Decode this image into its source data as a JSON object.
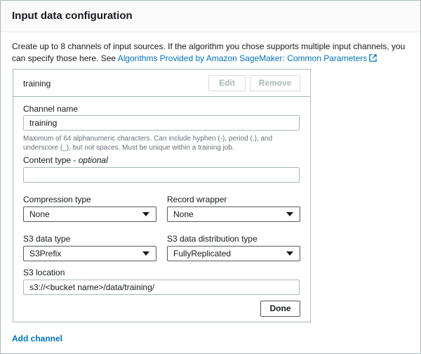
{
  "panel": {
    "title": "Input data configuration",
    "description": "Create up to 8 channels of input sources. If the algorithm you chose supports multiple input channels, you can specify those here. See ",
    "link_text": "Algorithms Provided by Amazon SageMaker: Common Parameters",
    "link_icon": "external-link-icon",
    "add_channel_label": "Add channel"
  },
  "channel": {
    "header_name": "training",
    "edit_label": "Edit",
    "remove_label": "Remove",
    "channel_name": {
      "label": "Channel name",
      "value": "training",
      "hint": "Maximum of 64 alphanumeric characters. Can include hyphen (-), period (.), and underscore (_), but not spaces. Must be unique within a training job."
    },
    "content_type": {
      "label": "Content type",
      "label_suffix": " - ",
      "optional": "optional",
      "value": ""
    },
    "compression_type": {
      "label": "Compression type",
      "value": "None"
    },
    "record_wrapper": {
      "label": "Record wrapper",
      "value": "None"
    },
    "s3_data_type": {
      "label": "S3 data type",
      "value": "S3Prefix"
    },
    "s3_distribution_type": {
      "label": "S3 data distribution type",
      "value": "FullyReplicated"
    },
    "s3_location": {
      "label": "S3 location",
      "value": "s3://<bucket name>/data/training/"
    },
    "done_label": "Done"
  },
  "colors": {
    "link": "#0073bb",
    "border": "#aab7b8",
    "text": "#16191f",
    "hint": "#687078",
    "disabled": "#aab7b8"
  }
}
